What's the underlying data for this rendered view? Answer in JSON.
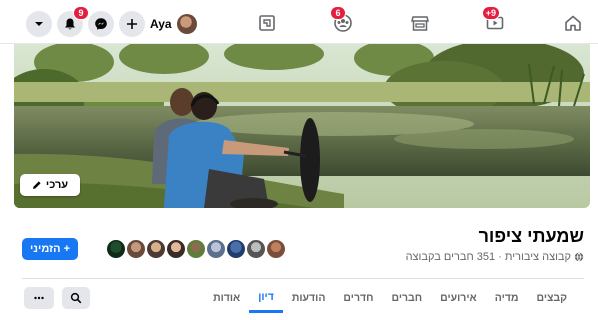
{
  "topbar": {
    "profile_name": "Aya",
    "notifications_badge": "9",
    "groups_badge": "6",
    "watch_badge": "+9",
    "icons": [
      "caret-down-icon",
      "bell-icon",
      "messenger-icon",
      "plus-icon",
      "pages-icon",
      "groups-icon",
      "marketplace-icon",
      "watch-icon",
      "home-icon"
    ]
  },
  "cover": {
    "edit_label": "ערכי"
  },
  "group": {
    "name": "שמעתי ציפור",
    "meta": "קבוצה ציבורית · 351 חברים בקבוצה",
    "invite_label": "הזמיני",
    "member_avatar_count": 9
  },
  "tabs": [
    {
      "label": "אודות",
      "active": false
    },
    {
      "label": "דיון",
      "active": true
    },
    {
      "label": "הודעות",
      "active": false
    },
    {
      "label": "חדרים",
      "active": false
    },
    {
      "label": "חברים",
      "active": false
    },
    {
      "label": "אירועים",
      "active": false
    },
    {
      "label": "מדיה",
      "active": false
    },
    {
      "label": "קבצים",
      "active": false
    }
  ],
  "colors": {
    "accent": "#1877f2",
    "badge": "#e41e3f",
    "muted": "#65676b"
  }
}
